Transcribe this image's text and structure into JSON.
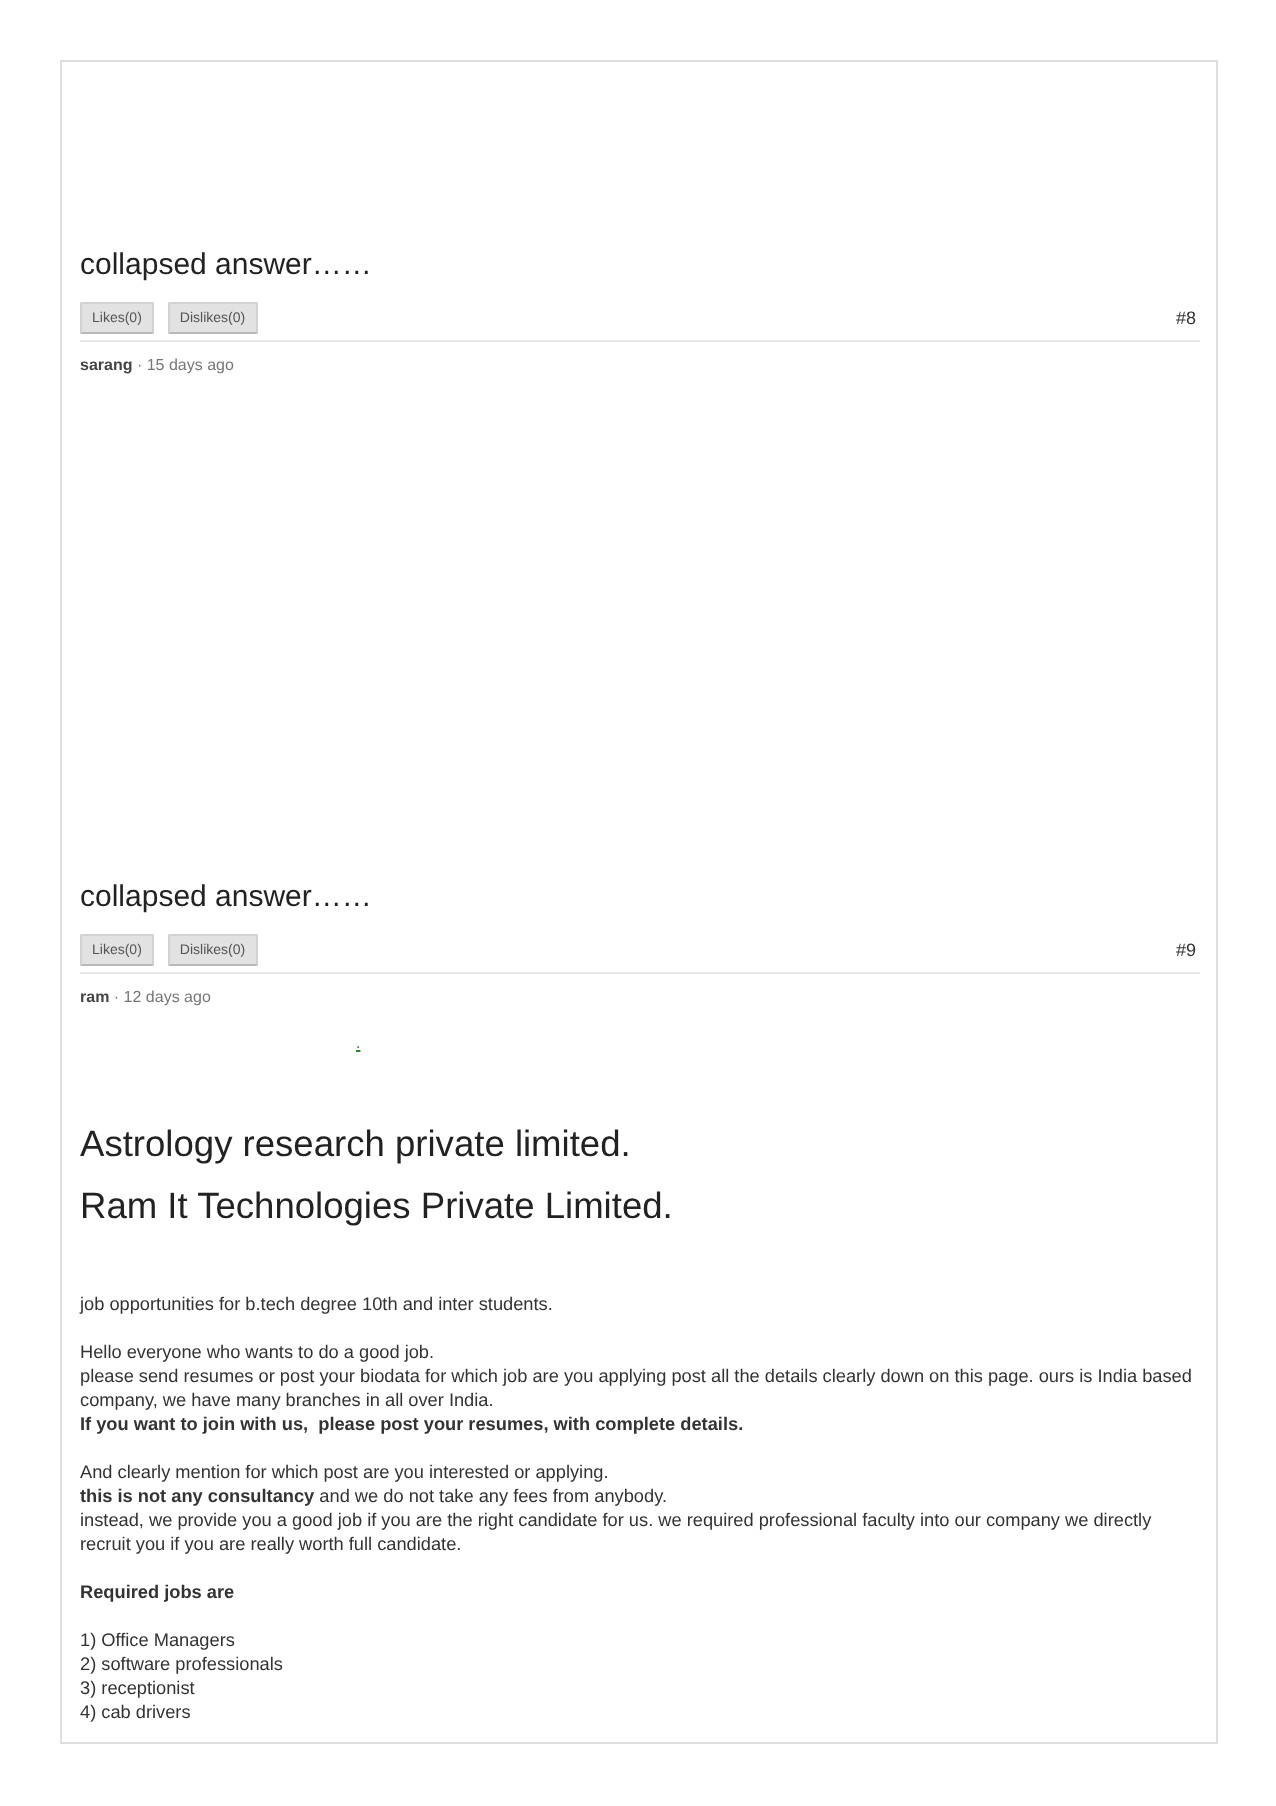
{
  "answers": [
    {
      "title": "collapsed answer……",
      "likes": "Likes(0)",
      "dislikes": "Dislikes(0)",
      "number": "#8",
      "meta": "**sarang** · 15 days ago"
    },
    {
      "title": "collapsed answer……",
      "likes": "Likes(0)",
      "dislikes": "Dislikes(0)",
      "number": "#9",
      "meta": "**ram** · 12 days ago"
    }
  ],
  "post": {
    "link": ".",
    "headings": [
      "Astrology research private limited.",
      "Ram It Technologies Private Limited."
    ],
    "paragraphs": [
      [
        {
          "text": "job opportunities for b.tech degree 10th and inter students.",
          "bold": false
        }
      ],
      [
        {
          "text": "Hello everyone who wants to do a good job.",
          "bold": false
        },
        {
          "text": "please send resumes or post your biodata for which job are you applying post all the details clearly down on this page. ours is India based company, we have many branches in all over India.",
          "bold": false
        },
        {
          "text": "If you want to join with us,  please post your resumes, with complete details.",
          "bold": true
        }
      ],
      [
        {
          "text": "And clearly mention for which post are you interested or applying.",
          "bold": false
        },
        {
          "text": "**this is not any consultancy** and we do not take any fees from anybody.",
          "bold": false
        },
        {
          "text": "instead, we provide you a good job if you are the right candidate for us. we required professional faculty into our company we directly recruit you if you are really worth full candidate.",
          "bold": false
        }
      ],
      [
        {
          "text": "Required jobs are",
          "bold": true
        }
      ],
      [
        {
          "text": "1) Office Managers",
          "bold": false
        },
        {
          "text": "2) software professionals",
          "bold": false
        },
        {
          "text": "3) receptionist",
          "bold": false
        },
        {
          "text": "4) cab drivers",
          "bold": false
        }
      ]
    ]
  }
}
